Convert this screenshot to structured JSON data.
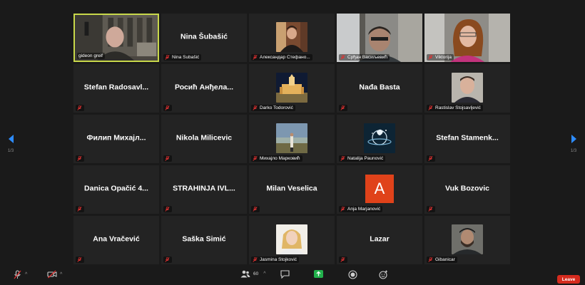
{
  "participants": [
    {
      "name": "gideon greif",
      "tile_text": "",
      "muted": false,
      "speaking": true,
      "media": "video"
    },
    {
      "name": "Nina Šubašić",
      "tile_text": "Nina Šubašić",
      "muted": true,
      "media": "none"
    },
    {
      "name": "Александар Стефано...",
      "tile_text": "",
      "muted": true,
      "media": "thumb"
    },
    {
      "name": "Срђан Васиљевић",
      "tile_text": "",
      "muted": true,
      "media": "video"
    },
    {
      "name": "Viktorija",
      "tile_text": "",
      "muted": true,
      "media": "video"
    },
    {
      "name": "",
      "tile_text": "Stefan  Radosavl...",
      "muted": true,
      "media": "none"
    },
    {
      "name": "",
      "tile_text": "Росић Анђела...",
      "muted": true,
      "media": "none"
    },
    {
      "name": "Darko Todorović",
      "tile_text": "",
      "muted": true,
      "media": "thumb"
    },
    {
      "name": "",
      "tile_text": "Nađa Basta",
      "muted": true,
      "media": "none"
    },
    {
      "name": "Rastislav Stojsavljević",
      "tile_text": "",
      "muted": true,
      "media": "thumb"
    },
    {
      "name": "",
      "tile_text": "Филип  Михајл...",
      "muted": true,
      "media": "none"
    },
    {
      "name": "",
      "tile_text": "Nikola Milicevic",
      "muted": true,
      "media": "none"
    },
    {
      "name": "Михајло Марковић",
      "tile_text": "",
      "muted": true,
      "media": "thumb"
    },
    {
      "name": "Natalija Paunović",
      "tile_text": "",
      "muted": true,
      "media": "thumb"
    },
    {
      "name": "",
      "tile_text": "Stefan  Stamenk...",
      "muted": true,
      "media": "none"
    },
    {
      "name": "",
      "tile_text": "Danica  Opačić  4...",
      "muted": true,
      "media": "none"
    },
    {
      "name": "",
      "tile_text": "STRAHINJA  IVL...",
      "muted": true,
      "media": "none"
    },
    {
      "name": "",
      "tile_text": "Milan Veselica",
      "muted": true,
      "media": "none"
    },
    {
      "name": "Anja Marjanović",
      "tile_text": "",
      "muted": true,
      "media": "letter",
      "letter": "A"
    },
    {
      "name": "",
      "tile_text": "Vuk Bozovic",
      "muted": true,
      "media": "none"
    },
    {
      "name": "",
      "tile_text": "Ana Vračević",
      "muted": true,
      "media": "none"
    },
    {
      "name": "",
      "tile_text": "Saška Simić",
      "muted": true,
      "media": "none"
    },
    {
      "name": "Jasmina Stojković",
      "tile_text": "",
      "muted": true,
      "media": "thumb"
    },
    {
      "name": "",
      "tile_text": "Lazar",
      "muted": true,
      "media": "none"
    },
    {
      "name": "Gibanicar",
      "tile_text": "",
      "muted": true,
      "media": "thumb"
    }
  ],
  "pagination": {
    "left": "1/3",
    "right": "1/3"
  },
  "toolbar": {
    "participants_count": "60",
    "leave_label": "Leave"
  },
  "colors": {
    "active_speaker_border": "#c8d84a",
    "leave": "#d52b1e",
    "muted_icon": "#e03131",
    "accent_blue": "#2d8cff",
    "share_green": "#22b14c"
  }
}
